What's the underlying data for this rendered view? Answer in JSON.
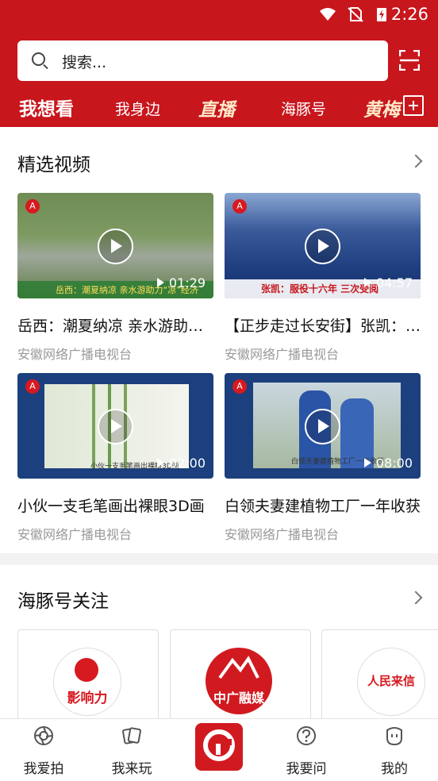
{
  "status_bar": {
    "time": "2:26"
  },
  "search": {
    "placeholder": "搜索..."
  },
  "top_tabs": [
    "我想看",
    "我身边",
    "直播",
    "海豚号",
    "黄梅"
  ],
  "featured": {
    "title": "精选视频",
    "videos": [
      {
        "title": "岳西：潮夏纳凉 亲水游助力“凉”经济",
        "source": "安徽网络广播电视台",
        "duration": "01:29",
        "caption": "岳西：潮夏纳凉 亲水游助力“凉”经济"
      },
      {
        "title": "【正步走过长安街】张凯：服役十六年 三次受阅",
        "source": "安徽网络广播电视台",
        "duration": "04:57",
        "caption": "张凯：服役十六年 三次受阅"
      },
      {
        "title": "小伙一支毛笔画出裸眼3D画",
        "source": "安徽网络广播电视台",
        "duration": "02:00",
        "caption": "小伙一支毛笔画出裸眼3D画"
      },
      {
        "title": "白领夫妻建植物工厂一年收获",
        "source": "安徽网络广播电视台",
        "duration": "08:00",
        "caption": "白领夫妻建植物工厂一年收获"
      }
    ]
  },
  "follow_section": {
    "title": "海豚号关注",
    "accounts": [
      {
        "logo_text": "影响力"
      },
      {
        "logo_text": "中广融媒"
      },
      {
        "logo_text": "人民来信"
      }
    ]
  },
  "bottom_nav": [
    "我爱拍",
    "我来玩",
    "",
    "我要问",
    "我的"
  ],
  "colors": {
    "brand": "#c8161d",
    "text_muted": "#999999"
  }
}
